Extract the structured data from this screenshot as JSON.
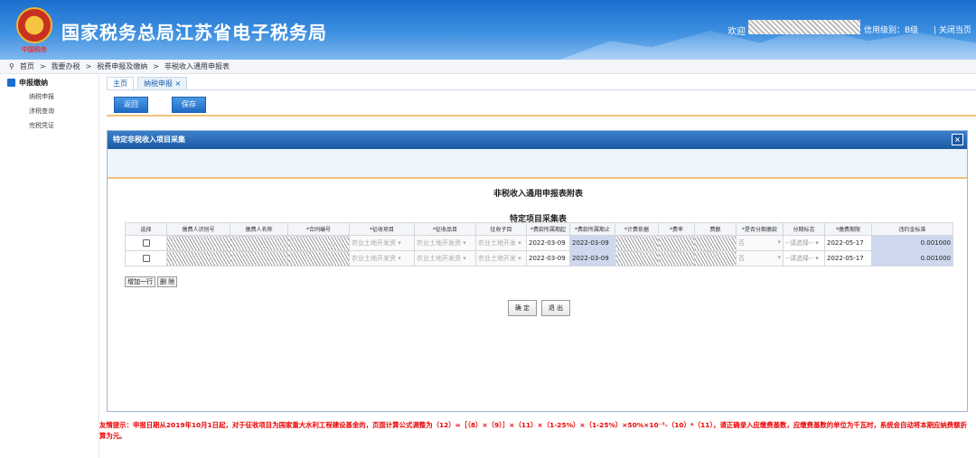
{
  "header": {
    "emblem_text": "中国税务",
    "title": "国家税务总局江苏省电子税务局",
    "welcome": "欢迎",
    "credit": "信用级别：B级",
    "logout": "| 关闭当页"
  },
  "breadcrumb": [
    "首页",
    ">",
    "我要办税",
    ">",
    "税费申报及缴纳",
    ">",
    "非税收入通用申报表"
  ],
  "sidebar": {
    "section": "申报缴纳",
    "items": [
      "纳税申报",
      "涉税查询",
      "完税凭证"
    ]
  },
  "tabs": [
    {
      "label": "主页",
      "active": false
    },
    {
      "label": "纳税申报 ×",
      "active": true
    }
  ],
  "toolbar": {
    "back": "返回",
    "save": "保存"
  },
  "dialog": {
    "title": "特定非税收入项目采集",
    "close": "×",
    "form_title": "非税收入通用申报表附表",
    "table_title": "特定项目采集表",
    "columns": [
      "选择",
      "缴费人识别号",
      "缴费人名称",
      "*合同编号",
      "*征收项目",
      "*征收品目",
      "征收子目",
      "*费款所属期起",
      "*费款所属期止",
      "*计费依据",
      "*费率",
      "费额",
      "*是否分期缴款",
      "分期标志",
      "*缴费期限",
      "违约金标准"
    ],
    "rows": [
      {
        "item": "农业土地开发资",
        "品目": "农业土地开发资",
        "子目": "农业土地开发",
        "start": "2022-03-09",
        "end": "2022-03-09",
        "installment": "否",
        "flag": "--请选择--",
        "deadline": "2022-05-17",
        "rate": "0.001000"
      },
      {
        "item": "农业土地开发资",
        "品目": "农业土地开发资",
        "子目": "农业土地开发",
        "start": "2022-03-09",
        "end": "2022-03-09",
        "installment": "否",
        "flag": "--请选择--",
        "deadline": "2022-05-17",
        "rate": "0.001000"
      }
    ],
    "add_row": "增加一行",
    "delete_row": "删 除",
    "confirm": "确 定",
    "exit": "退 出"
  },
  "notice": "友情提示：申报日期从2019年10月1日起，对于征收项目为国家重大水利工程建设基金的，页面计算公式调整为（12）=［（8）×（9）］×（11）×（1-25%）×（1-25%）×50%×10⁻³-（10）*（11），请正确录入应缴费基数，应缴费基数的单位为千瓦时，系统会自动将本期应纳费额折算为元。"
}
